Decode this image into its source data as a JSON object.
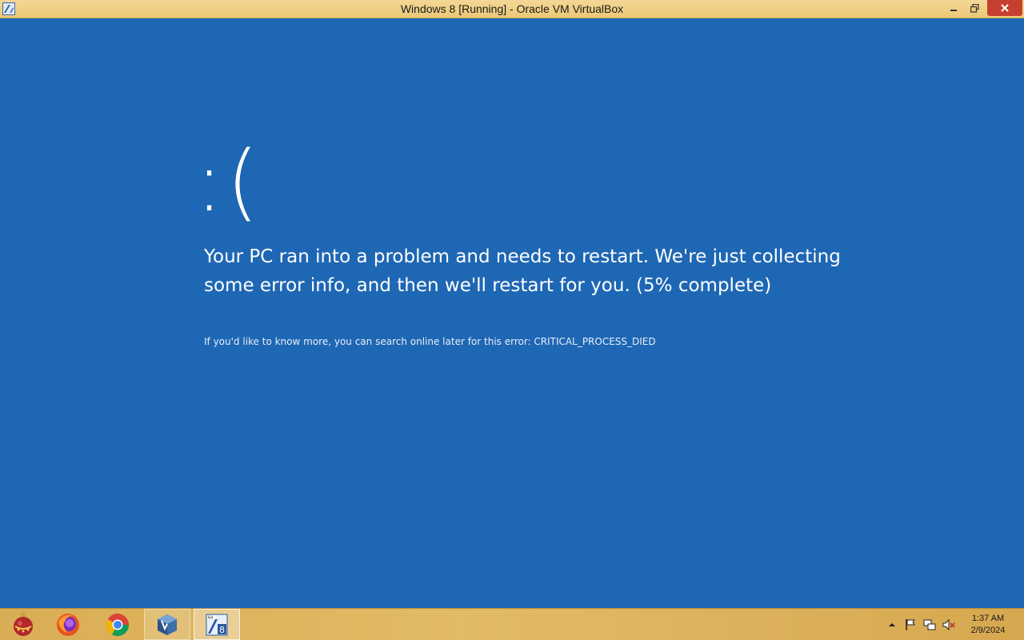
{
  "window": {
    "title": "Windows 8 [Running] - Oracle VM VirtualBox",
    "controls": {
      "minimize_icon": "minimize-icon",
      "restore_icon": "restore-icon",
      "close_icon": "close-icon"
    }
  },
  "bsod": {
    "face": ":(",
    "message": "Your PC ran into a problem and needs to restart. We're just collecting some error info, and then we'll restart for you. (5% complete)",
    "detail": "If you'd like to know more, you can search online later for this error: CRITICAL_PROCESS_DIED",
    "progress_percent": 5,
    "background_color": "#1e67b4"
  },
  "taskbar": {
    "items": [
      {
        "icon": "ornament-app-icon",
        "state": "normal"
      },
      {
        "icon": "firefox-icon",
        "state": "normal"
      },
      {
        "icon": "chrome-icon",
        "state": "normal"
      },
      {
        "icon": "virtualbox-icon",
        "state": "open"
      },
      {
        "icon": "windows8-vm-icon",
        "state": "active"
      }
    ],
    "tray": {
      "icons": [
        "show-hidden-icons-arrow-icon",
        "action-center-flag-icon",
        "network-icon",
        "volume-muted-icon"
      ]
    },
    "clock": {
      "time": "1:37 AM",
      "date": "2/9/2024"
    },
    "accent_color": "#e2bb66"
  }
}
